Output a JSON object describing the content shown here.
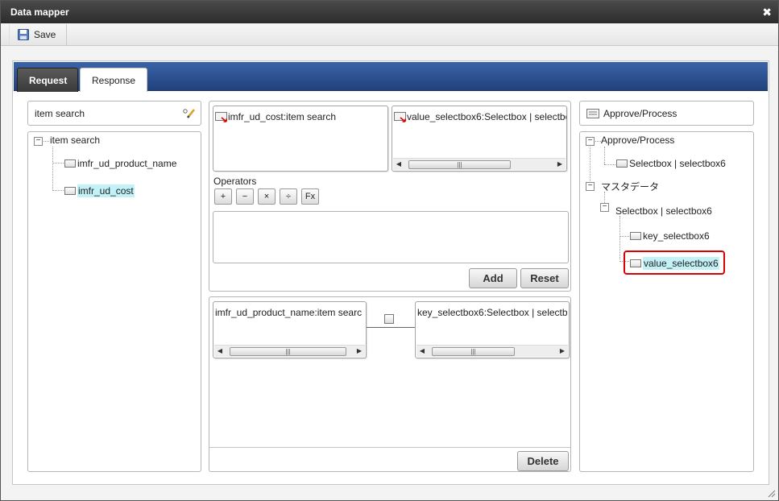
{
  "window": {
    "title": "Data mapper"
  },
  "toolbar": {
    "save_label": "Save"
  },
  "tabs": [
    {
      "label": "Request",
      "active": false
    },
    {
      "label": "Response",
      "active": true
    }
  ],
  "left": {
    "title": "item search",
    "tree": {
      "root": "item search",
      "children": [
        "imfr_ud_product_name",
        "imfr_ud_cost"
      ],
      "selected": "imfr_ud_cost"
    }
  },
  "middle": {
    "source_box": {
      "title": "imfr_ud_cost:item search"
    },
    "target_box": {
      "title": "value_selectbox6:Selectbox | selectbo"
    },
    "operators_label": "Operators",
    "operators": [
      "+",
      "−",
      "×",
      "÷",
      "Fx"
    ],
    "add_label": "Add",
    "reset_label": "Reset",
    "mapping": {
      "source": "imfr_ud_product_name:item searc",
      "target": "key_selectbox6:Selectbox | selectb"
    },
    "delete_label": "Delete"
  },
  "right": {
    "title": "Approve/Process",
    "tree": {
      "root": "Approve/Process",
      "root_child": "Selectbox | selectbox6",
      "group": "マスタデータ",
      "subgroup": "Selectbox | selectbox6",
      "leaves": [
        "key_selectbox6",
        "value_selectbox6"
      ],
      "selected": "value_selectbox6"
    }
  },
  "colors": {
    "tab_strip": "#2c4f92",
    "selection": "#c2f2f7",
    "highlight_border": "#dd0000"
  }
}
